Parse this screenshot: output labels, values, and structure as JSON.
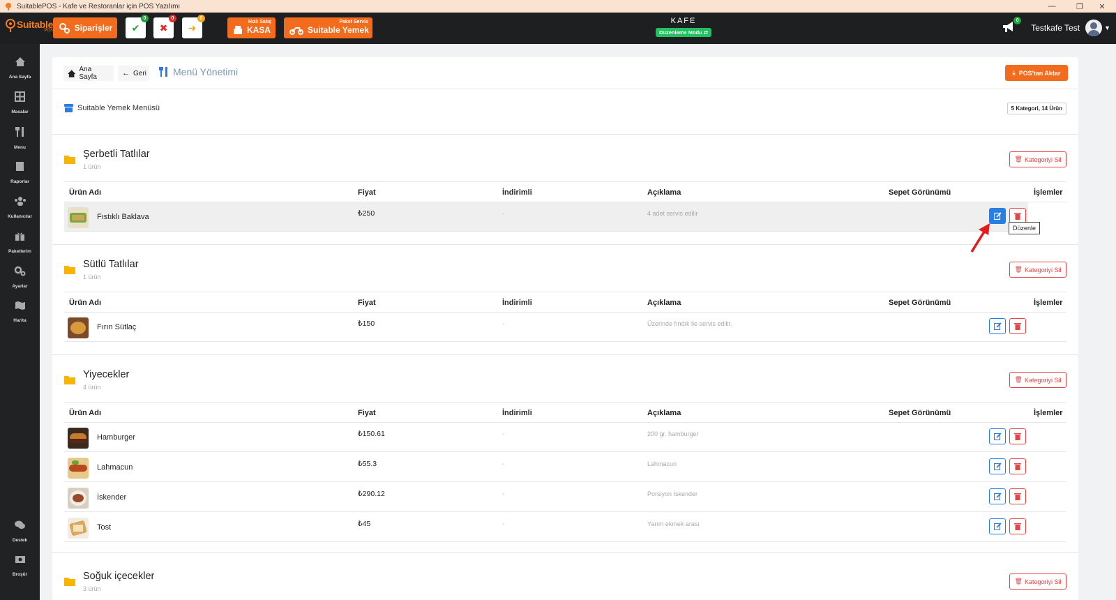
{
  "window": {
    "title": "SuitablePOS - Kafe ve Restoranlar için POS Yazılımı"
  },
  "brand": {
    "logo_text": "Suitable",
    "logo_sub": "POS"
  },
  "topbar": {
    "orders_label": "Siparişler",
    "approved_count": "0",
    "cancelled_count": "0",
    "pending_count": "0",
    "kasa_top": "Hızlı Satış",
    "kasa_label": "KASA",
    "delivery_top": "Paket Servis",
    "delivery_label": "Suitable Yemek",
    "venue": "KAFE",
    "mode": "Düzenleme Modu",
    "notif_count": "0",
    "user": "Testkafe Test"
  },
  "sidebar": [
    {
      "label": "Ana Sayfa",
      "icon": "home-icon"
    },
    {
      "label": "Masalar",
      "icon": "tables-icon"
    },
    {
      "label": "Menu",
      "icon": "utensils-icon"
    },
    {
      "label": "Raporlar",
      "icon": "report-icon"
    },
    {
      "label": "Kullanıcılar",
      "icon": "users-icon"
    },
    {
      "label": "Paketlerim",
      "icon": "gift-icon"
    },
    {
      "label": "Ayarlar",
      "icon": "gears-icon"
    },
    {
      "label": "Harita",
      "icon": "map-icon"
    },
    {
      "label": "Destek",
      "icon": "chat-icon"
    },
    {
      "label": "Broşür",
      "icon": "brochure-icon"
    }
  ],
  "header": {
    "home": "Ana Sayfa",
    "back": "Geri",
    "title": "Menü Yönetimi",
    "export": "POS'tan Aktar"
  },
  "menu": {
    "name": "Suitable Yemek Menüsü",
    "summary": "5 Kategori, 14 Ürün"
  },
  "columns": {
    "name": "Ürün Adı",
    "price": "Fiyat",
    "discount": "İndirimli",
    "description": "Açıklama",
    "basket": "Sepet Görünümü",
    "actions": "İşlemler"
  },
  "delete_category_label": "Kategoriyi Sil",
  "tooltip": "Düzenle",
  "categories": [
    {
      "title": "Şerbetli Tatlılar",
      "subtitle": "1 ürün",
      "products": [
        {
          "name": "Fıstıklı Baklava",
          "price": "₺250",
          "discount": "-",
          "description": "4 adet servis edilir"
        }
      ]
    },
    {
      "title": "Sütlü Tatlılar",
      "subtitle": "1 ürün",
      "products": [
        {
          "name": "Fırın Sütlaç",
          "price": "₺150",
          "discount": "-",
          "description": "Üzerinde fındık ile servis edilir."
        }
      ]
    },
    {
      "title": "Yiyecekler",
      "subtitle": "4 ürün",
      "products": [
        {
          "name": "Hamburger",
          "price": "₺150.61",
          "discount": "-",
          "description": "200 gr. hamburger"
        },
        {
          "name": "Lahmacun",
          "price": "₺55.3",
          "discount": "-",
          "description": "Lahmacun"
        },
        {
          "name": "İskender",
          "price": "₺290.12",
          "discount": "-",
          "description": "Porsiyon İskender"
        },
        {
          "name": "Tost",
          "price": "₺45",
          "discount": "-",
          "description": "Yarım ekmek arası"
        }
      ]
    },
    {
      "title": "Soğuk içecekler",
      "subtitle": "3 ürün",
      "products": []
    }
  ],
  "colors": {
    "accent": "#f36b1c",
    "edit": "#2a7de1",
    "delete": "#e04848",
    "sidebar": "#212224"
  }
}
